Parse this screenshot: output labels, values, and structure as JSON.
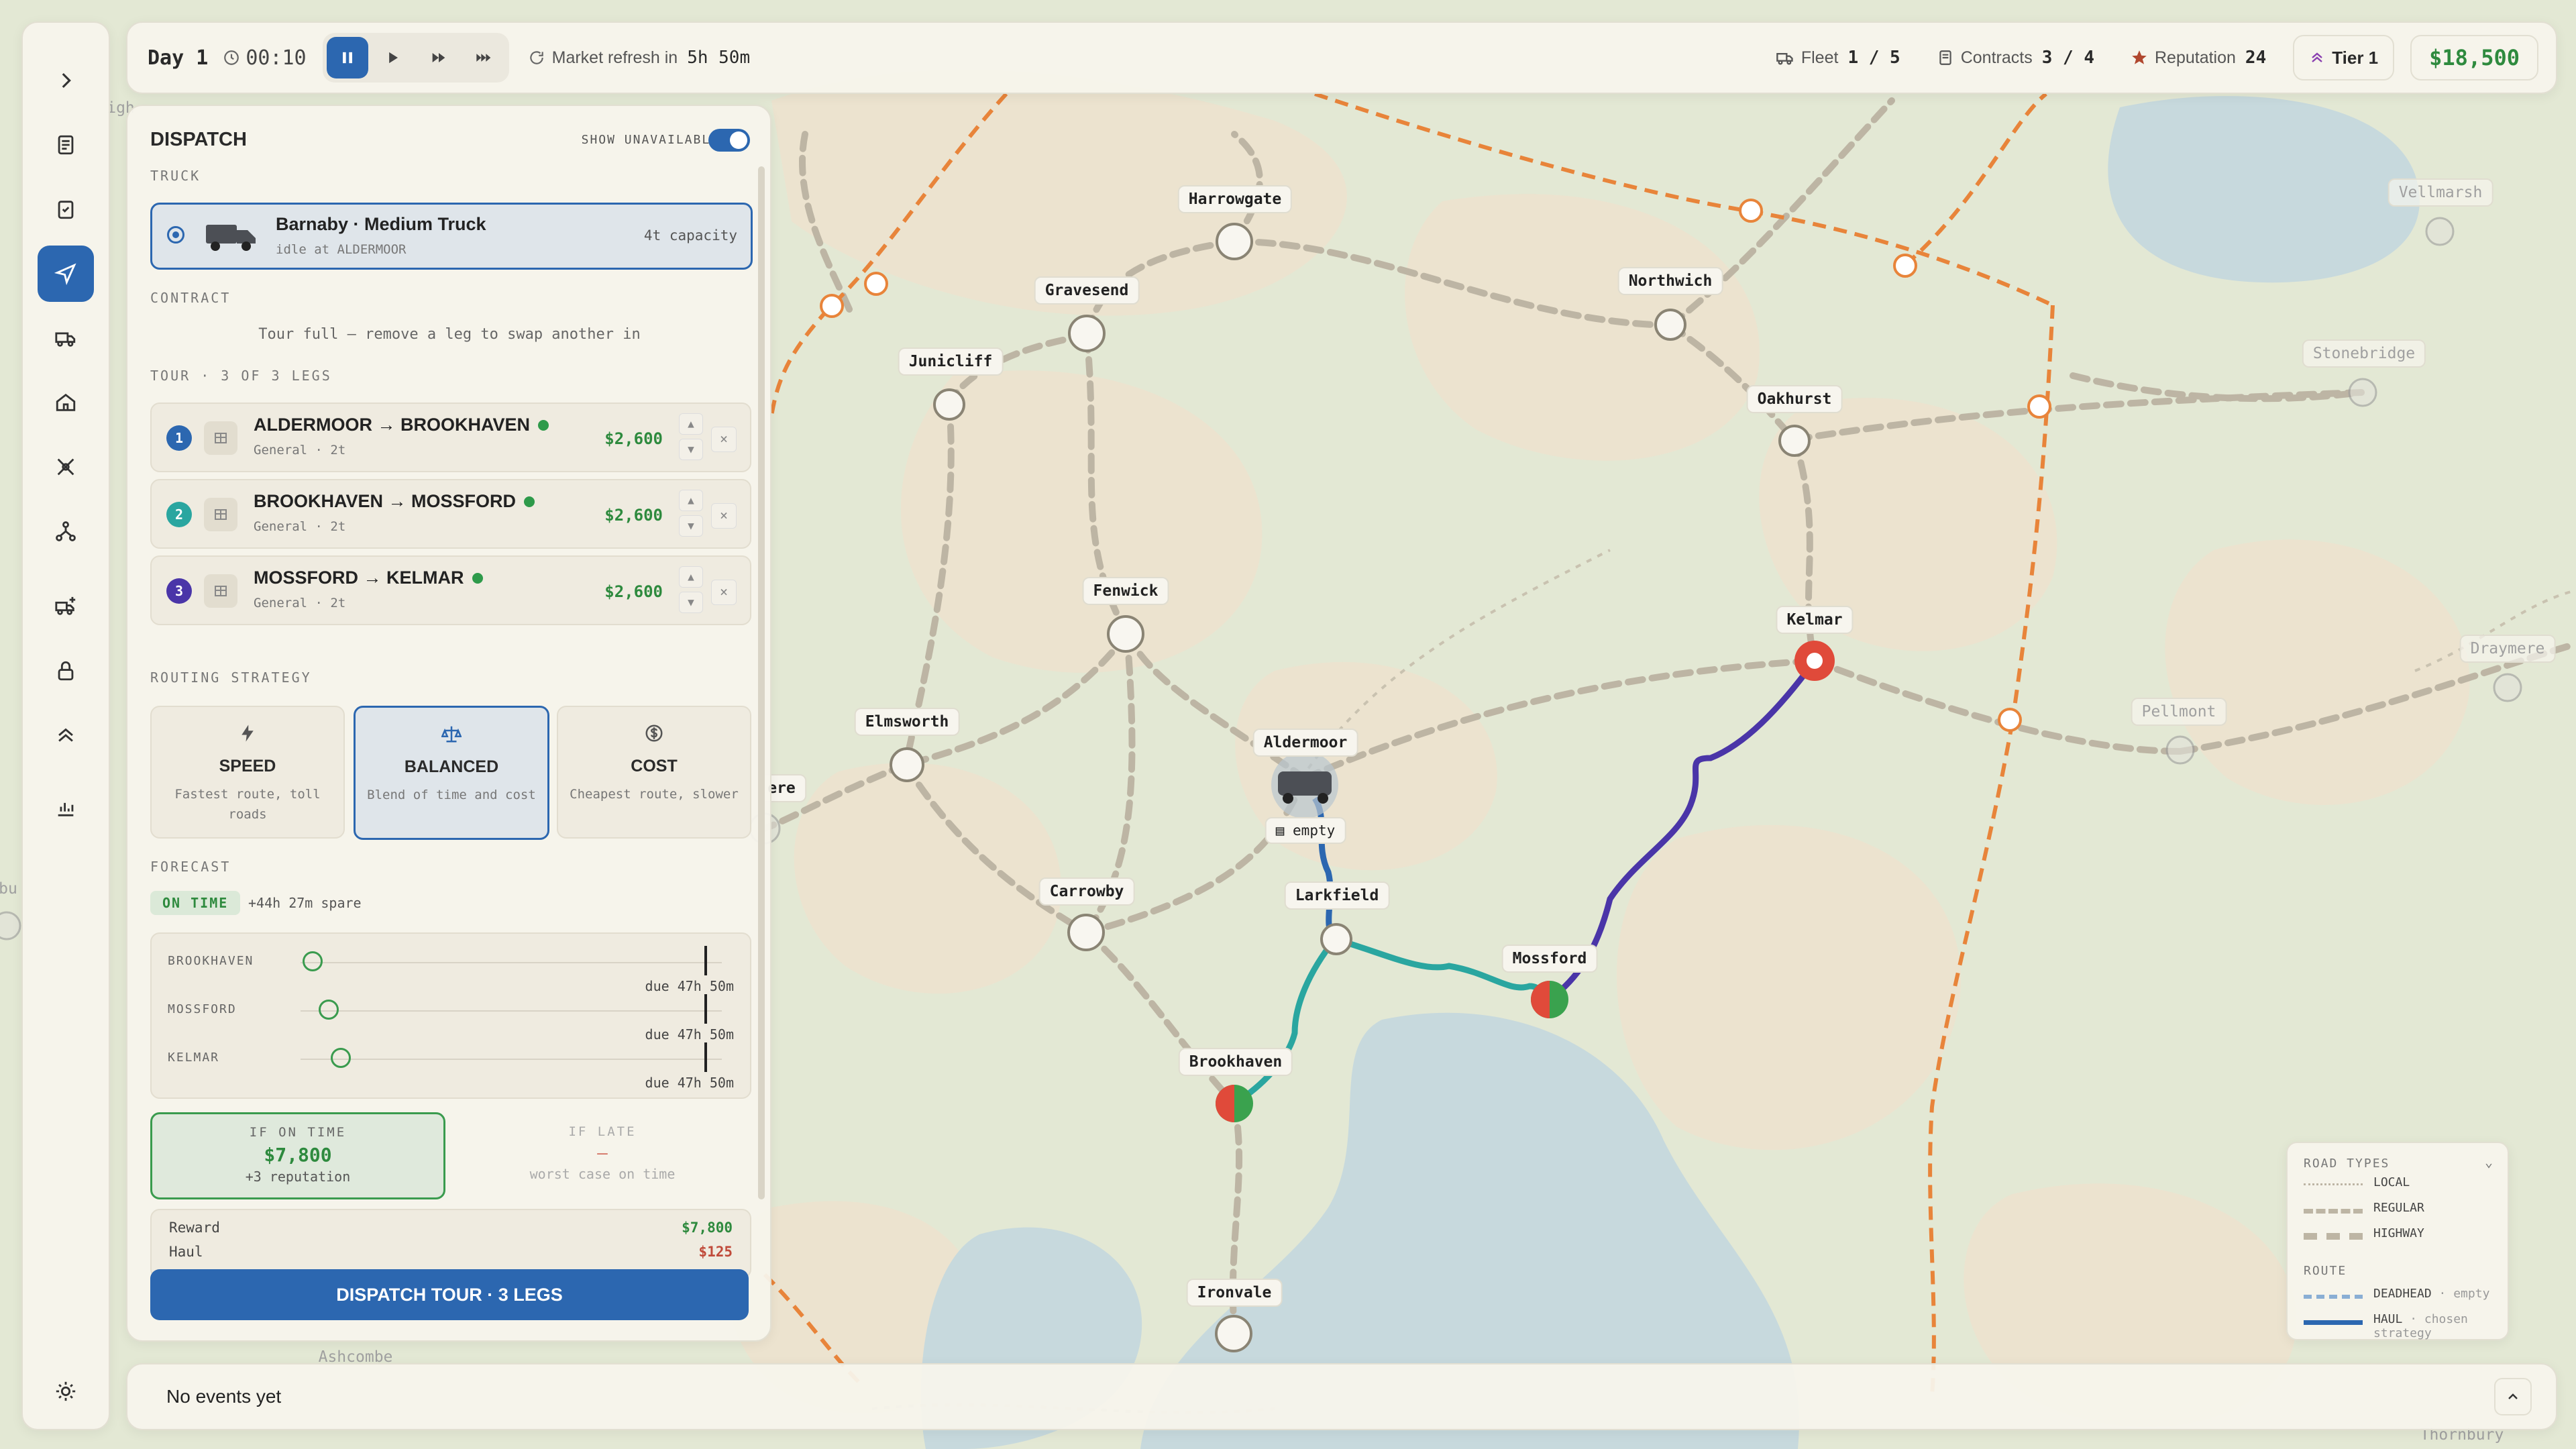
{
  "topbar": {
    "day": "Day 1",
    "clock": "00:10",
    "market_label": "Market refresh in",
    "market_value": "5h 50m",
    "fleet_label": "Fleet",
    "fleet_value": "1 / 5",
    "contracts_label": "Contracts",
    "contracts_value": "3 / 4",
    "reputation_label": "Reputation",
    "reputation_value": "24",
    "tier": "Tier 1",
    "cash": "$18,500"
  },
  "panel": {
    "title": "DISPATCH",
    "show_unavailable_label": "SHOW UNAVAILABLE",
    "show_unavailable_on": true,
    "truck_section": "TRUCK",
    "truck": {
      "name": "Barnaby · Medium Truck",
      "status": "idle at ALDERMOOR",
      "capacity": "4t capacity"
    },
    "contract_section": "CONTRACT",
    "contract_note": "Tour full — remove a leg to swap another in",
    "tour_section": "TOUR · 3 OF 3 LEGS",
    "legs": [
      {
        "num": "1",
        "route": "ALDERMOOR → BROOKHAVEN",
        "sub": "General · 2t",
        "price": "$2,600",
        "color": "#2c67b0"
      },
      {
        "num": "2",
        "route": "BROOKHAVEN → MOSSFORD",
        "sub": "General · 2t",
        "price": "$2,600",
        "color": "#2aa6a0"
      },
      {
        "num": "3",
        "route": "MOSSFORD → KELMAR",
        "sub": "General · 2t",
        "price": "$2,600",
        "color": "#4a35a8"
      }
    ],
    "routing_section": "ROUTING STRATEGY",
    "strategies": [
      {
        "name": "SPEED",
        "desc": "Fastest route, toll roads",
        "icon": "bolt-icon"
      },
      {
        "name": "BALANCED",
        "desc": "Blend of time and cost",
        "icon": "scale-icon",
        "selected": true
      },
      {
        "name": "COST",
        "desc": "Cheapest route, slower",
        "icon": "dollar-icon"
      }
    ],
    "forecast_section": "FORECAST",
    "forecast_badge": "ON TIME",
    "forecast_spare": "+44h 27m spare",
    "forecast_rows": [
      {
        "name": "BROOKHAVEN",
        "due": "due 47h 50m",
        "progress": 0.03
      },
      {
        "name": "MOSSFORD",
        "due": "due 47h 50m",
        "progress": 0.07
      },
      {
        "name": "KELMAR",
        "due": "due 47h 50m",
        "progress": 0.1
      }
    ],
    "if_on_time_label": "IF ON TIME",
    "if_on_time_value": "$7,800",
    "if_on_time_sub": "+3 reputation",
    "if_late_label": "IF LATE",
    "if_late_value": "—",
    "if_late_sub": "worst case on time",
    "breakdown": [
      {
        "label": "Reward",
        "value": "$7,800"
      },
      {
        "label": "Haul",
        "value": "$125"
      }
    ],
    "dispatch_button": "DISPATCH TOUR · 3 LEGS"
  },
  "map": {
    "truck_tag": "empty",
    "cities": [
      {
        "name": "Harrowgate"
      },
      {
        "name": "Gravesend"
      },
      {
        "name": "Junicliff"
      },
      {
        "name": "Northwich"
      },
      {
        "name": "Oakhurst"
      },
      {
        "name": "Fenwick"
      },
      {
        "name": "Elmsworth"
      },
      {
        "name": "Aldermoor"
      },
      {
        "name": "Kelmar"
      },
      {
        "name": "Larkfield"
      },
      {
        "name": "Carrowby"
      },
      {
        "name": "Mossford"
      },
      {
        "name": "Brookhaven"
      },
      {
        "name": "Ironvale"
      }
    ],
    "dim_cities": [
      {
        "name": "Vellmarsh"
      },
      {
        "name": "Stonebridge"
      },
      {
        "name": "Draymere"
      },
      {
        "name": "Pellmont"
      },
      {
        "name": "Ashcombe"
      },
      {
        "name": "Thornbury"
      },
      {
        "name": "ere"
      },
      {
        "name": "igh"
      },
      {
        "name": "bu"
      }
    ]
  },
  "legend": {
    "road_title": "ROAD TYPES",
    "roads": [
      "LOCAL",
      "REGULAR",
      "HIGHWAY"
    ],
    "route_title": "ROUTE",
    "deadhead": "DEADHEAD",
    "deadhead_note": "· empty",
    "haul": "HAUL",
    "haul_note": "· chosen strategy"
  },
  "events": {
    "text": "No events yet"
  }
}
